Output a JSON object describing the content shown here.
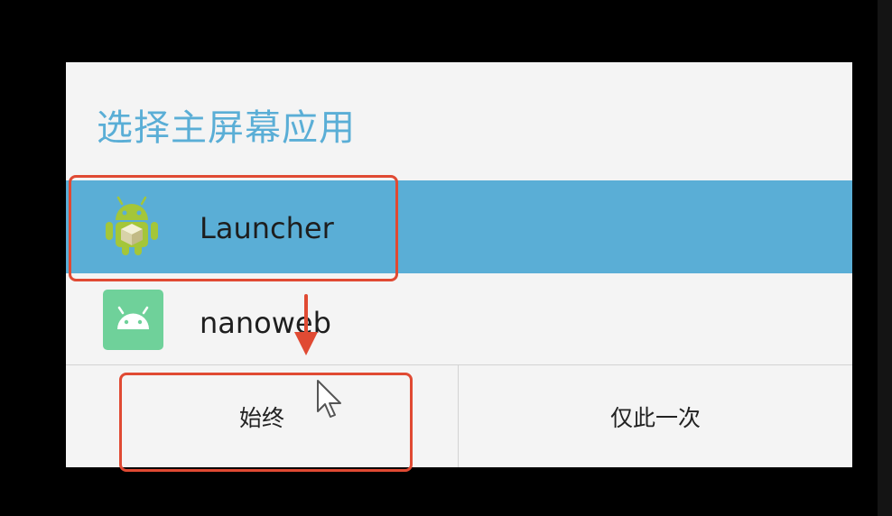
{
  "dialog": {
    "title": "选择主屏幕应用",
    "apps": [
      {
        "label": "Launcher",
        "selected": true,
        "icon": "android-robot-icon"
      },
      {
        "label": "nanoweb",
        "selected": false,
        "icon": "android-app-icon"
      }
    ],
    "buttons": {
      "always": "始终",
      "just_once": "仅此一次"
    }
  },
  "colors": {
    "accent": "#5aaed6",
    "dialog_bg": "#f4f4f4",
    "annotation": "#e04a33",
    "android_green": "#a4c639",
    "nanoweb_tile": "#6fd19a"
  }
}
